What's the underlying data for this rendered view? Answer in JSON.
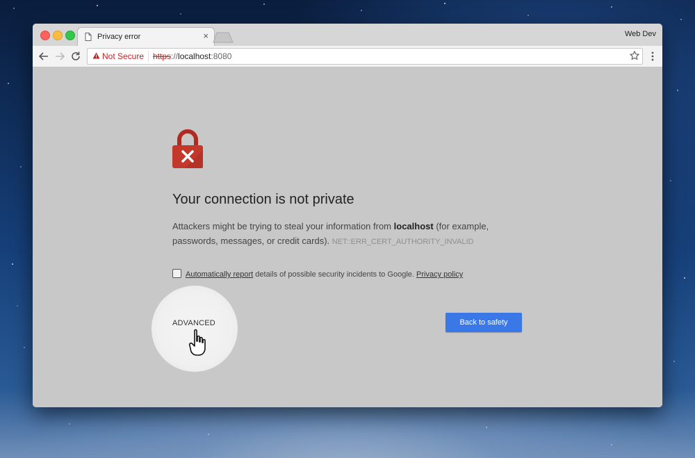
{
  "browser": {
    "tab_title": "Privacy error",
    "tab_close": "×",
    "profile_name": "Web Dev",
    "security_label": "Not Secure",
    "url_scheme": "https",
    "url_separator": "://",
    "url_host": "localhost",
    "url_port": ":8080"
  },
  "page": {
    "heading": "Your connection is not private",
    "desc_part1": "Attackers might be trying to steal your information from ",
    "desc_host": "localhost",
    "desc_part2": " (for example, passwords, messages, or credit cards).",
    "error_code": "NET::ERR_CERT_AUTHORITY_INVALID",
    "report_link": "Automatically report",
    "report_text": " details of possible security incidents to Google. ",
    "privacy_link": "Privacy policy",
    "advanced_label": "ADVANCED",
    "back_button": "Back to safety"
  },
  "colors": {
    "error_red": "#c5221f",
    "lock_red": "#c4382c",
    "primary_blue": "#3b78e7",
    "page_bg": "#c8c8c8"
  },
  "icons": [
    "document-icon",
    "back-arrow-icon",
    "forward-arrow-icon",
    "reload-icon",
    "warning-icon",
    "star-icon",
    "menu-dots-icon",
    "lock-error-icon",
    "hand-cursor-icon"
  ]
}
